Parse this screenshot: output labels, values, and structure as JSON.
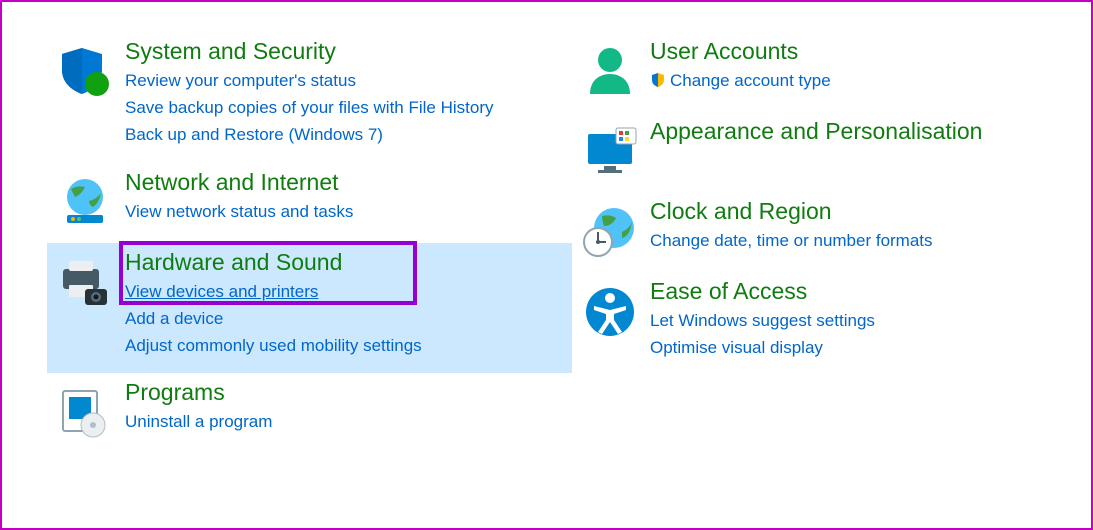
{
  "categories": {
    "system": {
      "title": "System and Security",
      "links": {
        "review": "Review your computer's status",
        "backup": "Save backup copies of your files with File History",
        "restore": "Back up and Restore (Windows 7)"
      }
    },
    "network": {
      "title": "Network and Internet",
      "links": {
        "status": "View network status and tasks"
      }
    },
    "hardware": {
      "title": "Hardware and Sound",
      "links": {
        "devices": "View devices and printers",
        "add": "Add a device",
        "mobility": "Adjust commonly used mobility settings"
      }
    },
    "programs": {
      "title": "Programs",
      "links": {
        "uninstall": "Uninstall a program"
      }
    },
    "user": {
      "title": "User Accounts",
      "links": {
        "change": "Change account type"
      }
    },
    "appearance": {
      "title": "Appearance and Personalisation"
    },
    "clock": {
      "title": "Clock and Region",
      "links": {
        "change": "Change date, time or number formats"
      }
    },
    "ease": {
      "title": "Ease of Access",
      "links": {
        "suggest": "Let Windows suggest settings",
        "optimise": "Optimise visual display"
      }
    }
  }
}
